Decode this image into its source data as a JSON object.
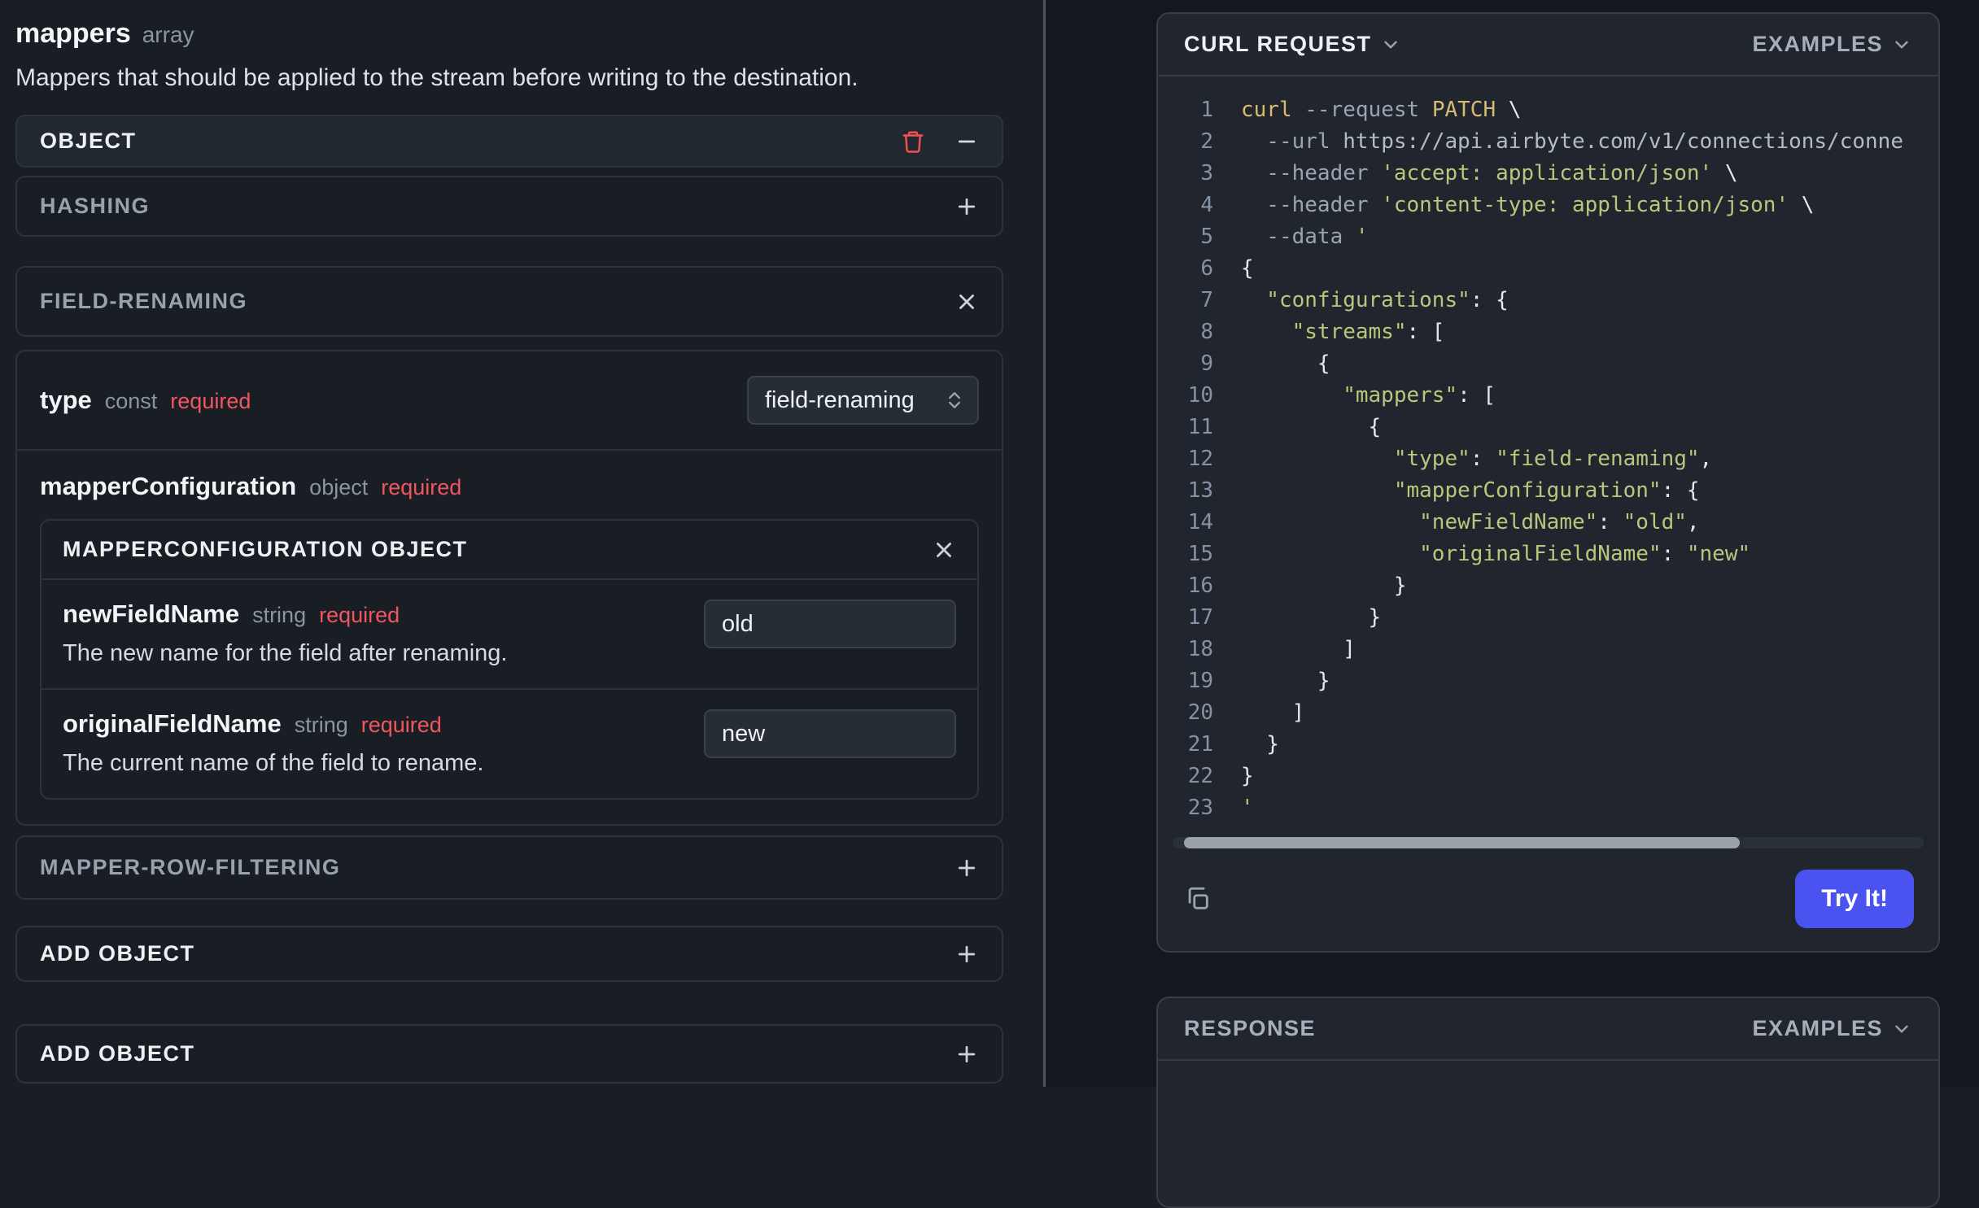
{
  "colors": {
    "accent_button": "#4a53ef",
    "required_text": "#f0565f",
    "danger_icon": "#ef5350",
    "code_string": "#b9c77d",
    "code_command": "#d8bb72",
    "code_flag": "#9aa5b0",
    "code_url": "#b3bcc6",
    "code_punct": "#e3e8ee",
    "line_number": "#8593a4"
  },
  "left": {
    "field_title": "mappers",
    "field_type": "array",
    "description": "Mappers that should be applied to the stream before writing to the destination.",
    "object_header": "OBJECT",
    "hashing": {
      "label": "HASHING"
    },
    "field_renaming": {
      "label": "FIELD-RENAMING",
      "type_row": {
        "name": "type",
        "meta": "const",
        "required": "required",
        "select_value": "field-renaming"
      },
      "mapper_configuration": {
        "name": "mapperConfiguration",
        "meta": "object",
        "required": "required"
      },
      "mapperconfig_object": {
        "header": "MAPPERCONFIGURATION OBJECT",
        "fields": [
          {
            "name": "newFieldName",
            "meta": "string",
            "required": "required",
            "value": "old",
            "description": "The new name for the field after renaming."
          },
          {
            "name": "originalFieldName",
            "meta": "string",
            "required": "required",
            "value": "new",
            "description": "The current name of the field to rename."
          }
        ]
      }
    },
    "mapper_row_filtering": {
      "label": "MAPPER-ROW-FILTERING"
    },
    "add_object_inner": {
      "label": "ADD OBJECT"
    },
    "add_object_outer": {
      "label": "ADD OBJECT"
    }
  },
  "request_panel": {
    "title": "CURL REQUEST",
    "examples_label": "EXAMPLES",
    "try_button": "Try It!",
    "code_lines": [
      [
        [
          "c",
          "curl"
        ],
        [
          "f",
          " --request"
        ],
        [
          "c",
          " PATCH"
        ],
        [
          "n",
          " \\"
        ]
      ],
      [
        [
          "f",
          "  --url"
        ],
        [
          "u",
          " https://api.airbyte.com/v1/connections/conne"
        ]
      ],
      [
        [
          "f",
          "  --header"
        ],
        [
          "s",
          " 'accept: application/json'"
        ],
        [
          "n",
          " \\"
        ]
      ],
      [
        [
          "f",
          "  --header"
        ],
        [
          "s",
          " 'content-type: application/json'"
        ],
        [
          "n",
          " \\"
        ]
      ],
      [
        [
          "f",
          "  --data"
        ],
        [
          "s",
          " '"
        ]
      ],
      [
        [
          "n",
          "{"
        ]
      ],
      [
        [
          "s",
          "  \"configurations\""
        ],
        [
          "n",
          ": {"
        ]
      ],
      [
        [
          "s",
          "    \"streams\""
        ],
        [
          "n",
          ": ["
        ]
      ],
      [
        [
          "n",
          "      {"
        ]
      ],
      [
        [
          "s",
          "        \"mappers\""
        ],
        [
          "n",
          ": ["
        ]
      ],
      [
        [
          "n",
          "          {"
        ]
      ],
      [
        [
          "s",
          "            \"type\""
        ],
        [
          "n",
          ": "
        ],
        [
          "s",
          "\"field-renaming\""
        ],
        [
          "n",
          ","
        ]
      ],
      [
        [
          "s",
          "            \"mapperConfiguration\""
        ],
        [
          "n",
          ": {"
        ]
      ],
      [
        [
          "s",
          "              \"newFieldName\""
        ],
        [
          "n",
          ": "
        ],
        [
          "s",
          "\"old\""
        ],
        [
          "n",
          ","
        ]
      ],
      [
        [
          "s",
          "              \"originalFieldName\""
        ],
        [
          "n",
          ": "
        ],
        [
          "s",
          "\"new\""
        ]
      ],
      [
        [
          "n",
          "            }"
        ]
      ],
      [
        [
          "n",
          "          }"
        ]
      ],
      [
        [
          "n",
          "        ]"
        ]
      ],
      [
        [
          "n",
          "      }"
        ]
      ],
      [
        [
          "n",
          "    ]"
        ]
      ],
      [
        [
          "n",
          "  }"
        ]
      ],
      [
        [
          "n",
          "}"
        ]
      ],
      [
        [
          "s",
          "'"
        ]
      ]
    ]
  },
  "response_panel": {
    "title": "RESPONSE",
    "examples_label": "EXAMPLES"
  }
}
